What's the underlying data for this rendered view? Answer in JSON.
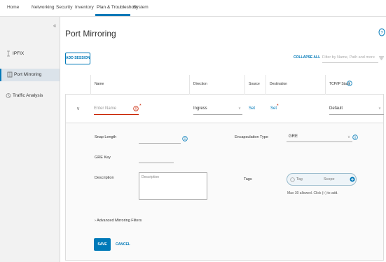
{
  "nav": {
    "tabs": [
      "Home",
      "Networking",
      "Security",
      "Inventory",
      "Plan & Troubleshoot",
      "System"
    ],
    "active_index": 4
  },
  "sidebar": {
    "items": [
      {
        "label": "IPFIX",
        "icon": "ipfix-icon"
      },
      {
        "label": "Port Mirroring",
        "icon": "port-mirroring-icon"
      },
      {
        "label": "Traffic Analysis",
        "icon": "traffic-analysis-icon"
      }
    ],
    "active_index": 1
  },
  "page": {
    "title": "Port Mirroring",
    "add_session": "ADD SESSION",
    "collapse_all": "COLLAPSE ALL",
    "filter_placeholder": "Filter by Name, Path and more"
  },
  "table": {
    "headers": {
      "name": "Name",
      "direction": "Direction",
      "source": "Source",
      "destination": "Destination",
      "stack": "TCP/IP Stack"
    }
  },
  "row": {
    "name_placeholder": "Enter Name",
    "required_mark": "*",
    "direction_value": "Ingress",
    "source_link": "Set",
    "destination_link": "Set",
    "stack_value": "Default"
  },
  "details": {
    "snap_length_label": "Snap Length",
    "gre_key_label": "GRE Key",
    "description_label": "Description",
    "description_placeholder": "Description",
    "encapsulation_label": "Encapsulation Type",
    "encapsulation_value": "GRE",
    "tags_label": "Tags",
    "tag_placeholder": "Tag",
    "scope_placeholder": "Scope",
    "tags_help": "Max 30 allowed. Click (+) to add.",
    "advanced_filters": "Advanced Mirroring Filters"
  },
  "actions": {
    "save": "SAVE",
    "cancel": "CANCEL"
  },
  "colors": {
    "accent": "#0079b8",
    "error": "#c92100"
  }
}
